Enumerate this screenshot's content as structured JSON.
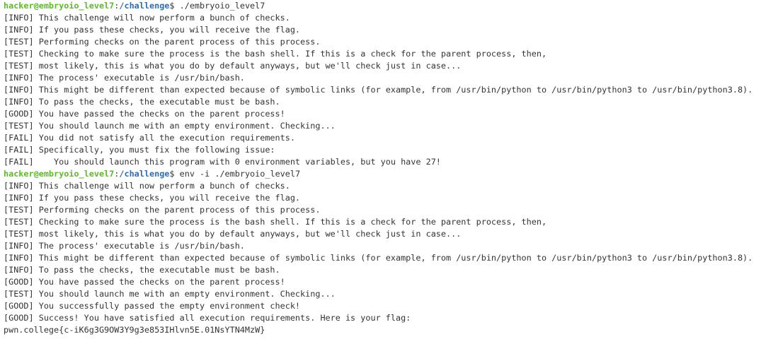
{
  "colors": {
    "prompt_user": "#5fb82c",
    "prompt_path": "#2f6db5",
    "text": "#333333",
    "background": "#ffffff"
  },
  "session": [
    {
      "prompt": {
        "user_host": "hacker@embryoio_level7",
        "sep": ":",
        "path": "/challenge",
        "symbol": "$ ",
        "command": "./embryoio_level7"
      },
      "output": [
        "[INFO] This challenge will now perform a bunch of checks.",
        "[INFO] If you pass these checks, you will receive the flag.",
        "[TEST] Performing checks on the parent process of this process.",
        "[TEST] Checking to make sure the process is the bash shell. If this is a check for the parent process, then,",
        "[TEST] most likely, this is what you do by default anyways, but we'll check just in case...",
        "[INFO] The process' executable is /usr/bin/bash.",
        "[INFO] This might be different than expected because of symbolic links (for example, from /usr/bin/python to /usr/bin/python3 to /usr/bin/python3.8).",
        "[INFO] To pass the checks, the executable must be bash.",
        "[GOOD] You have passed the checks on the parent process!",
        "[TEST] You should launch me with an empty environment. Checking...",
        "[FAIL] You did not satisfy all the execution requirements.",
        "[FAIL] Specifically, you must fix the following issue:",
        "[FAIL]    You should launch this program with 0 environment variables, but you have 27!"
      ]
    },
    {
      "prompt": {
        "user_host": "hacker@embryoio_level7",
        "sep": ":",
        "path": "/challenge",
        "symbol": "$ ",
        "command": "env -i ./embryoio_level7"
      },
      "output": [
        "[INFO] This challenge will now perform a bunch of checks.",
        "[INFO] If you pass these checks, you will receive the flag.",
        "[TEST] Performing checks on the parent process of this process.",
        "[TEST] Checking to make sure the process is the bash shell. If this is a check for the parent process, then,",
        "[TEST] most likely, this is what you do by default anyways, but we'll check just in case...",
        "[INFO] The process' executable is /usr/bin/bash.",
        "[INFO] This might be different than expected because of symbolic links (for example, from /usr/bin/python to /usr/bin/python3 to /usr/bin/python3.8).",
        "[INFO] To pass the checks, the executable must be bash.",
        "[GOOD] You have passed the checks on the parent process!",
        "[TEST] You should launch me with an empty environment. Checking...",
        "[GOOD] You successfully passed the empty environment check!",
        "[GOOD] Success! You have satisfied all execution requirements. Here is your flag:",
        "pwn.college{c-iK6g3G9OW3Y9g3e853IHlvn5E.01NsYTN4MzW}"
      ]
    }
  ]
}
